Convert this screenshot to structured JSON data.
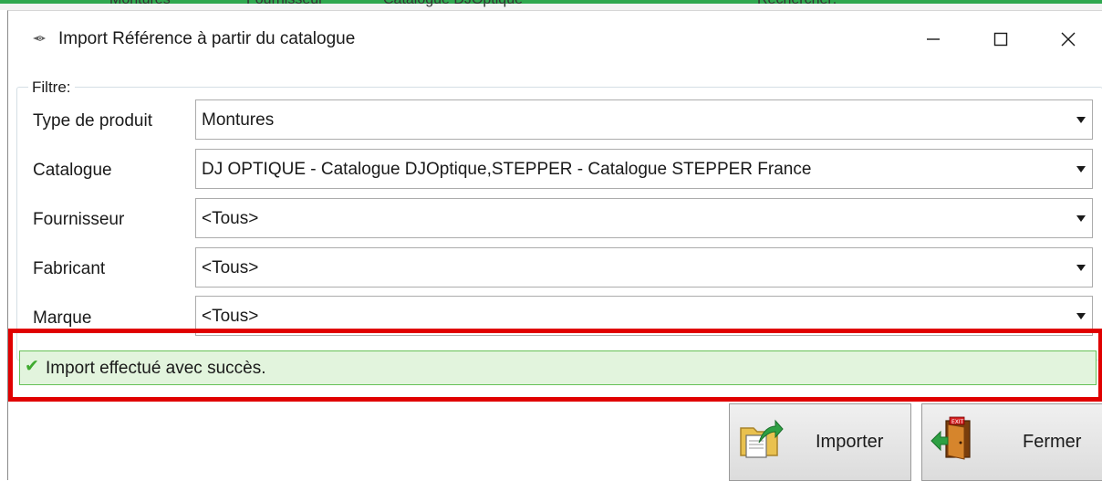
{
  "background_app": {
    "fragments": [
      "Montures",
      "Fournisseur",
      "Catalogue DJOptique",
      "Rechercher:"
    ]
  },
  "window": {
    "title": "Import Référence à partir du catalogue",
    "controls": {
      "minimize_icon": "minimize-icon",
      "maximize_icon": "maximize-icon",
      "close_icon": "close-icon"
    }
  },
  "filter": {
    "label": "Filtre:",
    "rows": [
      {
        "label": "Type de produit",
        "value": "Montures"
      },
      {
        "label": "Catalogue",
        "value": "DJ OPTIQUE - Catalogue DJOptique,STEPPER - Catalogue STEPPER France"
      },
      {
        "label": "Fournisseur",
        "value": "<Tous>"
      },
      {
        "label": "Fabricant",
        "value": "<Tous>"
      },
      {
        "label": "Marque",
        "value": "<Tous>"
      }
    ]
  },
  "status": {
    "icon": "checkmark-icon",
    "message": "Import effectué avec succès.",
    "color": "#e2f4dd",
    "highlight_color": "#e00000"
  },
  "buttons": {
    "import": {
      "label": "Importer",
      "icon": "import-folder-icon"
    },
    "close": {
      "label": "Fermer",
      "icon": "exit-door-icon"
    }
  }
}
